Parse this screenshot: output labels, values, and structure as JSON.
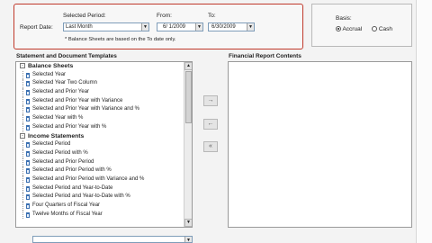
{
  "report_date": {
    "label": "Report Date:",
    "selected_period_label": "Selected Period:",
    "selected_period_value": "Last Month",
    "from_label": "From:",
    "from_value": "6/ 1/2009",
    "to_label": "To:",
    "to_value": "6/30/2009",
    "note": "* Balance Sheets are based on the To date only."
  },
  "basis": {
    "label": "Basis:",
    "options": [
      {
        "label": "Accrual",
        "selected": true
      },
      {
        "label": "Cash",
        "selected": false
      }
    ]
  },
  "templates": {
    "heading": "Statement and Document Templates",
    "groups": [
      {
        "name": "Balance Sheets",
        "expander": "-",
        "items": [
          "Selected Year",
          "Selected Year Two Column",
          "Selected and Prior Year",
          "Selected and Prior Year with Variance",
          "Selected and Prior Year with Variance and %",
          "Selected Year with %",
          "Selected and Prior Year with %"
        ]
      },
      {
        "name": "Income Statements",
        "expander": "-",
        "items": [
          "Selected Period",
          "Selected Period with %",
          "Selected and Prior Period",
          "Selected and Prior Period with %",
          "Selected and Prior Period with Variance and %",
          "Selected Period and Year-to-Date",
          "Selected Period and Year-to-Date with %",
          "Four Quarters of Fiscal Year",
          "Twelve Months of Fiscal Year"
        ]
      }
    ]
  },
  "contents": {
    "heading": "Financial Report Contents"
  },
  "transfer_buttons": [
    {
      "glyph": "→",
      "name": "add-button"
    },
    {
      "glyph": "←",
      "name": "remove-button"
    },
    {
      "glyph": "«",
      "name": "remove-all-button"
    }
  ]
}
